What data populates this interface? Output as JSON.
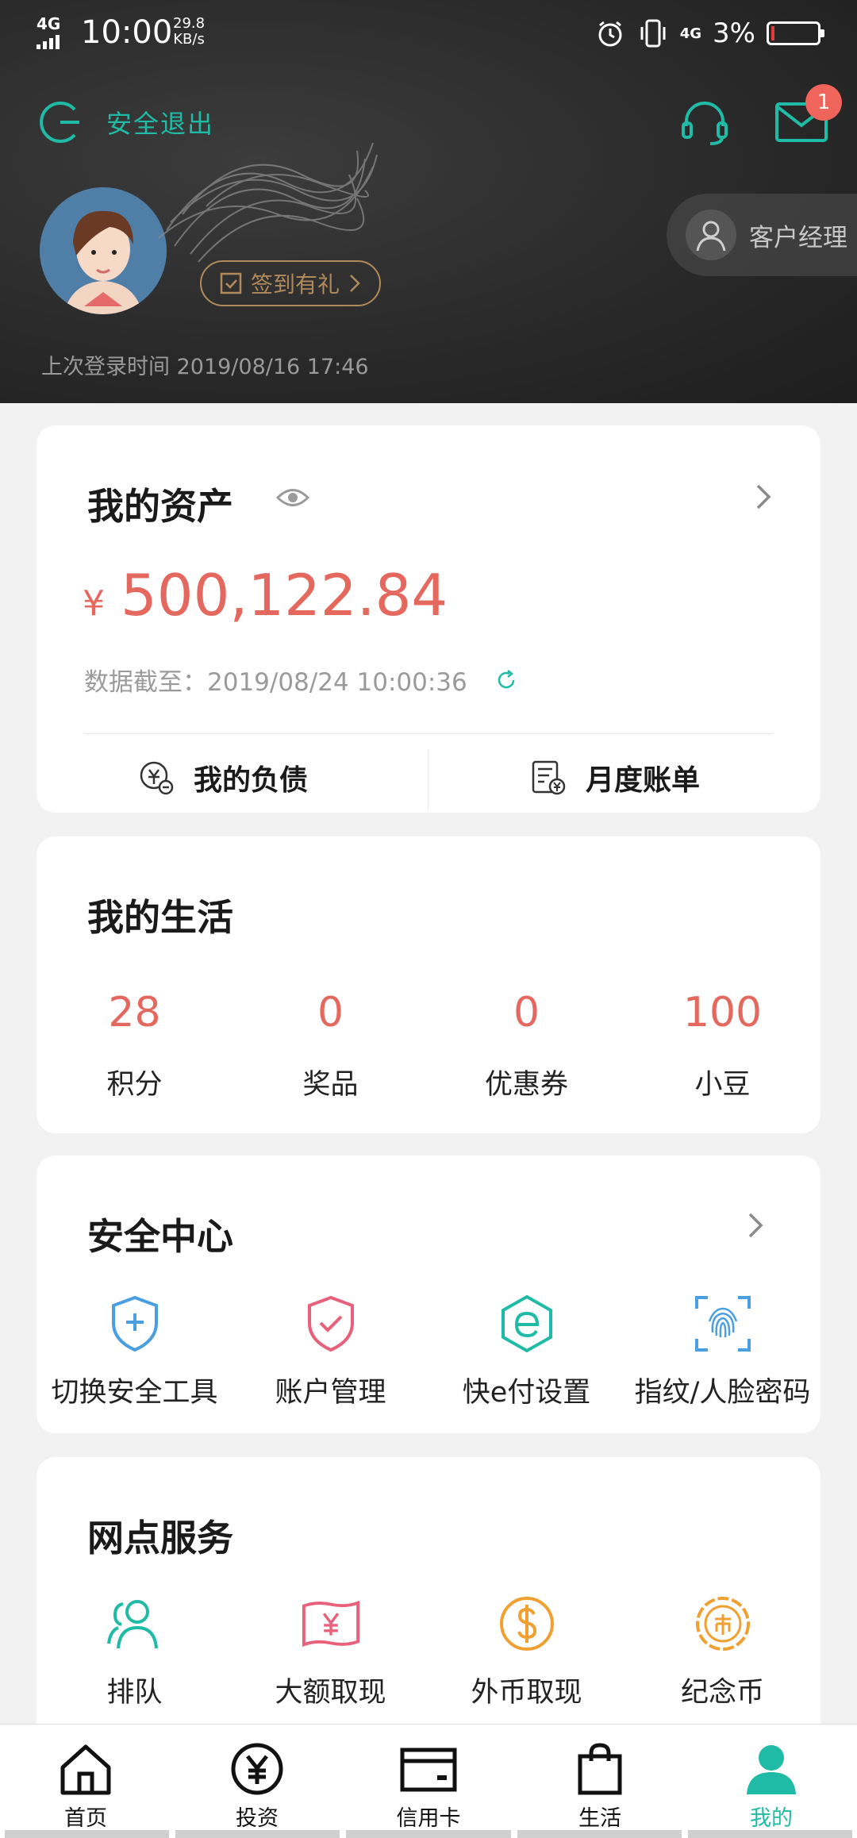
{
  "status_bar": {
    "network": "4G",
    "time": "10:00",
    "speed_value": "29.8",
    "speed_unit": "KB/s",
    "network2": "4G",
    "battery": "3%"
  },
  "header": {
    "logout_label": "安全退出",
    "message_badge": "1",
    "signin_label": "签到有礼",
    "manager_label": "客户经理",
    "last_login": "上次登录时间 2019/08/16 17:46"
  },
  "assets": {
    "title": "我的资产",
    "currency": "¥",
    "amount": "500,122.84",
    "as_of": "数据截至：2019/08/24 10:00:36",
    "liabilities_label": "我的负债",
    "monthly_bill_label": "月度账单"
  },
  "life": {
    "title": "我的生活",
    "items": [
      {
        "value": "28",
        "label": "积分"
      },
      {
        "value": "0",
        "label": "奖品"
      },
      {
        "value": "0",
        "label": "优惠券"
      },
      {
        "value": "100",
        "label": "小豆"
      }
    ]
  },
  "security": {
    "title": "安全中心",
    "items": [
      {
        "label": "切换安全工具",
        "icon": "shield-switch-icon"
      },
      {
        "label": "账户管理",
        "icon": "shield-check-icon"
      },
      {
        "label": "快e付设置",
        "icon": "e-pay-icon"
      },
      {
        "label": "指纹/人脸密码",
        "icon": "fingerprint-icon"
      }
    ]
  },
  "branch": {
    "title": "网点服务",
    "items": [
      {
        "label": "排队",
        "icon": "queue-icon"
      },
      {
        "label": "大额取现",
        "icon": "cash-withdraw-icon"
      },
      {
        "label": "外币取现",
        "icon": "foreign-currency-icon"
      },
      {
        "label": "纪念币",
        "icon": "commemorative-coin-icon"
      }
    ]
  },
  "tabbar": {
    "items": [
      {
        "label": "首页",
        "icon": "home-icon"
      },
      {
        "label": "投资",
        "icon": "yuan-circle-icon"
      },
      {
        "label": "信用卡",
        "icon": "credit-card-icon"
      },
      {
        "label": "生活",
        "icon": "shopping-bag-icon"
      },
      {
        "label": "我的",
        "icon": "user-icon"
      }
    ],
    "active_index": 4
  },
  "colors": {
    "accent": "#1fbba6",
    "amount": "#e5685e",
    "badge": "#f0655b",
    "signin": "#b18a5c"
  }
}
